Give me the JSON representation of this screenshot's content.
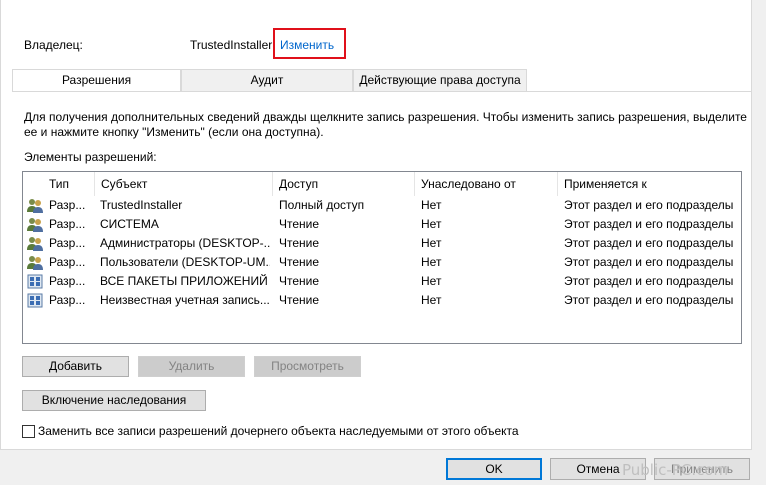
{
  "owner": {
    "label": "Владелец:",
    "value": "TrustedInstaller",
    "change_link": "Изменить"
  },
  "tabs": [
    {
      "label": "Разрешения",
      "active": true
    },
    {
      "label": "Аудит",
      "active": false
    },
    {
      "label": "Действующие права доступа",
      "active": false
    }
  ],
  "hint_text": "Для получения дополнительных сведений дважды щелкните запись разрешения. Чтобы изменить запись разрешения, выделите ее и нажмите кнопку \"Изменить\" (если она доступна).",
  "entries_label": "Элементы разрешений:",
  "columns": [
    "Тип",
    "Субъект",
    "Доступ",
    "Унаследовано от",
    "Применяется к"
  ],
  "rows": [
    {
      "icon": "user-group-icon",
      "type": "Разр...",
      "subject": "TrustedInstaller",
      "access": "Полный доступ",
      "inherited": "Нет",
      "applies": "Этот раздел и его подразделы"
    },
    {
      "icon": "user-group-icon",
      "type": "Разр...",
      "subject": "СИСТЕМА",
      "access": "Чтение",
      "inherited": "Нет",
      "applies": "Этот раздел и его подразделы"
    },
    {
      "icon": "user-group-icon",
      "type": "Разр...",
      "subject": "Администраторы (DESKTOP-...",
      "access": "Чтение",
      "inherited": "Нет",
      "applies": "Этот раздел и его подразделы"
    },
    {
      "icon": "user-group-icon",
      "type": "Разр...",
      "subject": "Пользователи (DESKTOP-UM...",
      "access": "Чтение",
      "inherited": "Нет",
      "applies": "Этот раздел и его подразделы"
    },
    {
      "icon": "app-package-icon",
      "type": "Разр...",
      "subject": "ВСЕ ПАКЕТЫ ПРИЛОЖЕНИЙ",
      "access": "Чтение",
      "inherited": "Нет",
      "applies": "Этот раздел и его подразделы"
    },
    {
      "icon": "app-package-icon",
      "type": "Разр...",
      "subject": "Неизвестная учетная запись...",
      "access": "Чтение",
      "inherited": "Нет",
      "applies": "Этот раздел и его подразделы"
    }
  ],
  "buttons": {
    "add": "Добавить",
    "remove": "Удалить",
    "view": "Просмотреть",
    "inherit": "Включение наследования"
  },
  "replace_checkbox": {
    "label": "Заменить все записи разрешений дочернего объекта наследуемыми от этого объекта",
    "checked": false
  },
  "dialog_buttons": {
    "ok": "OK",
    "cancel": "Отмена",
    "apply": "Применить"
  },
  "watermark": "Public-PC.com",
  "colors": {
    "link": "#0066cc",
    "highlight_box": "#e0101a",
    "primary_border": "#0078d7"
  }
}
